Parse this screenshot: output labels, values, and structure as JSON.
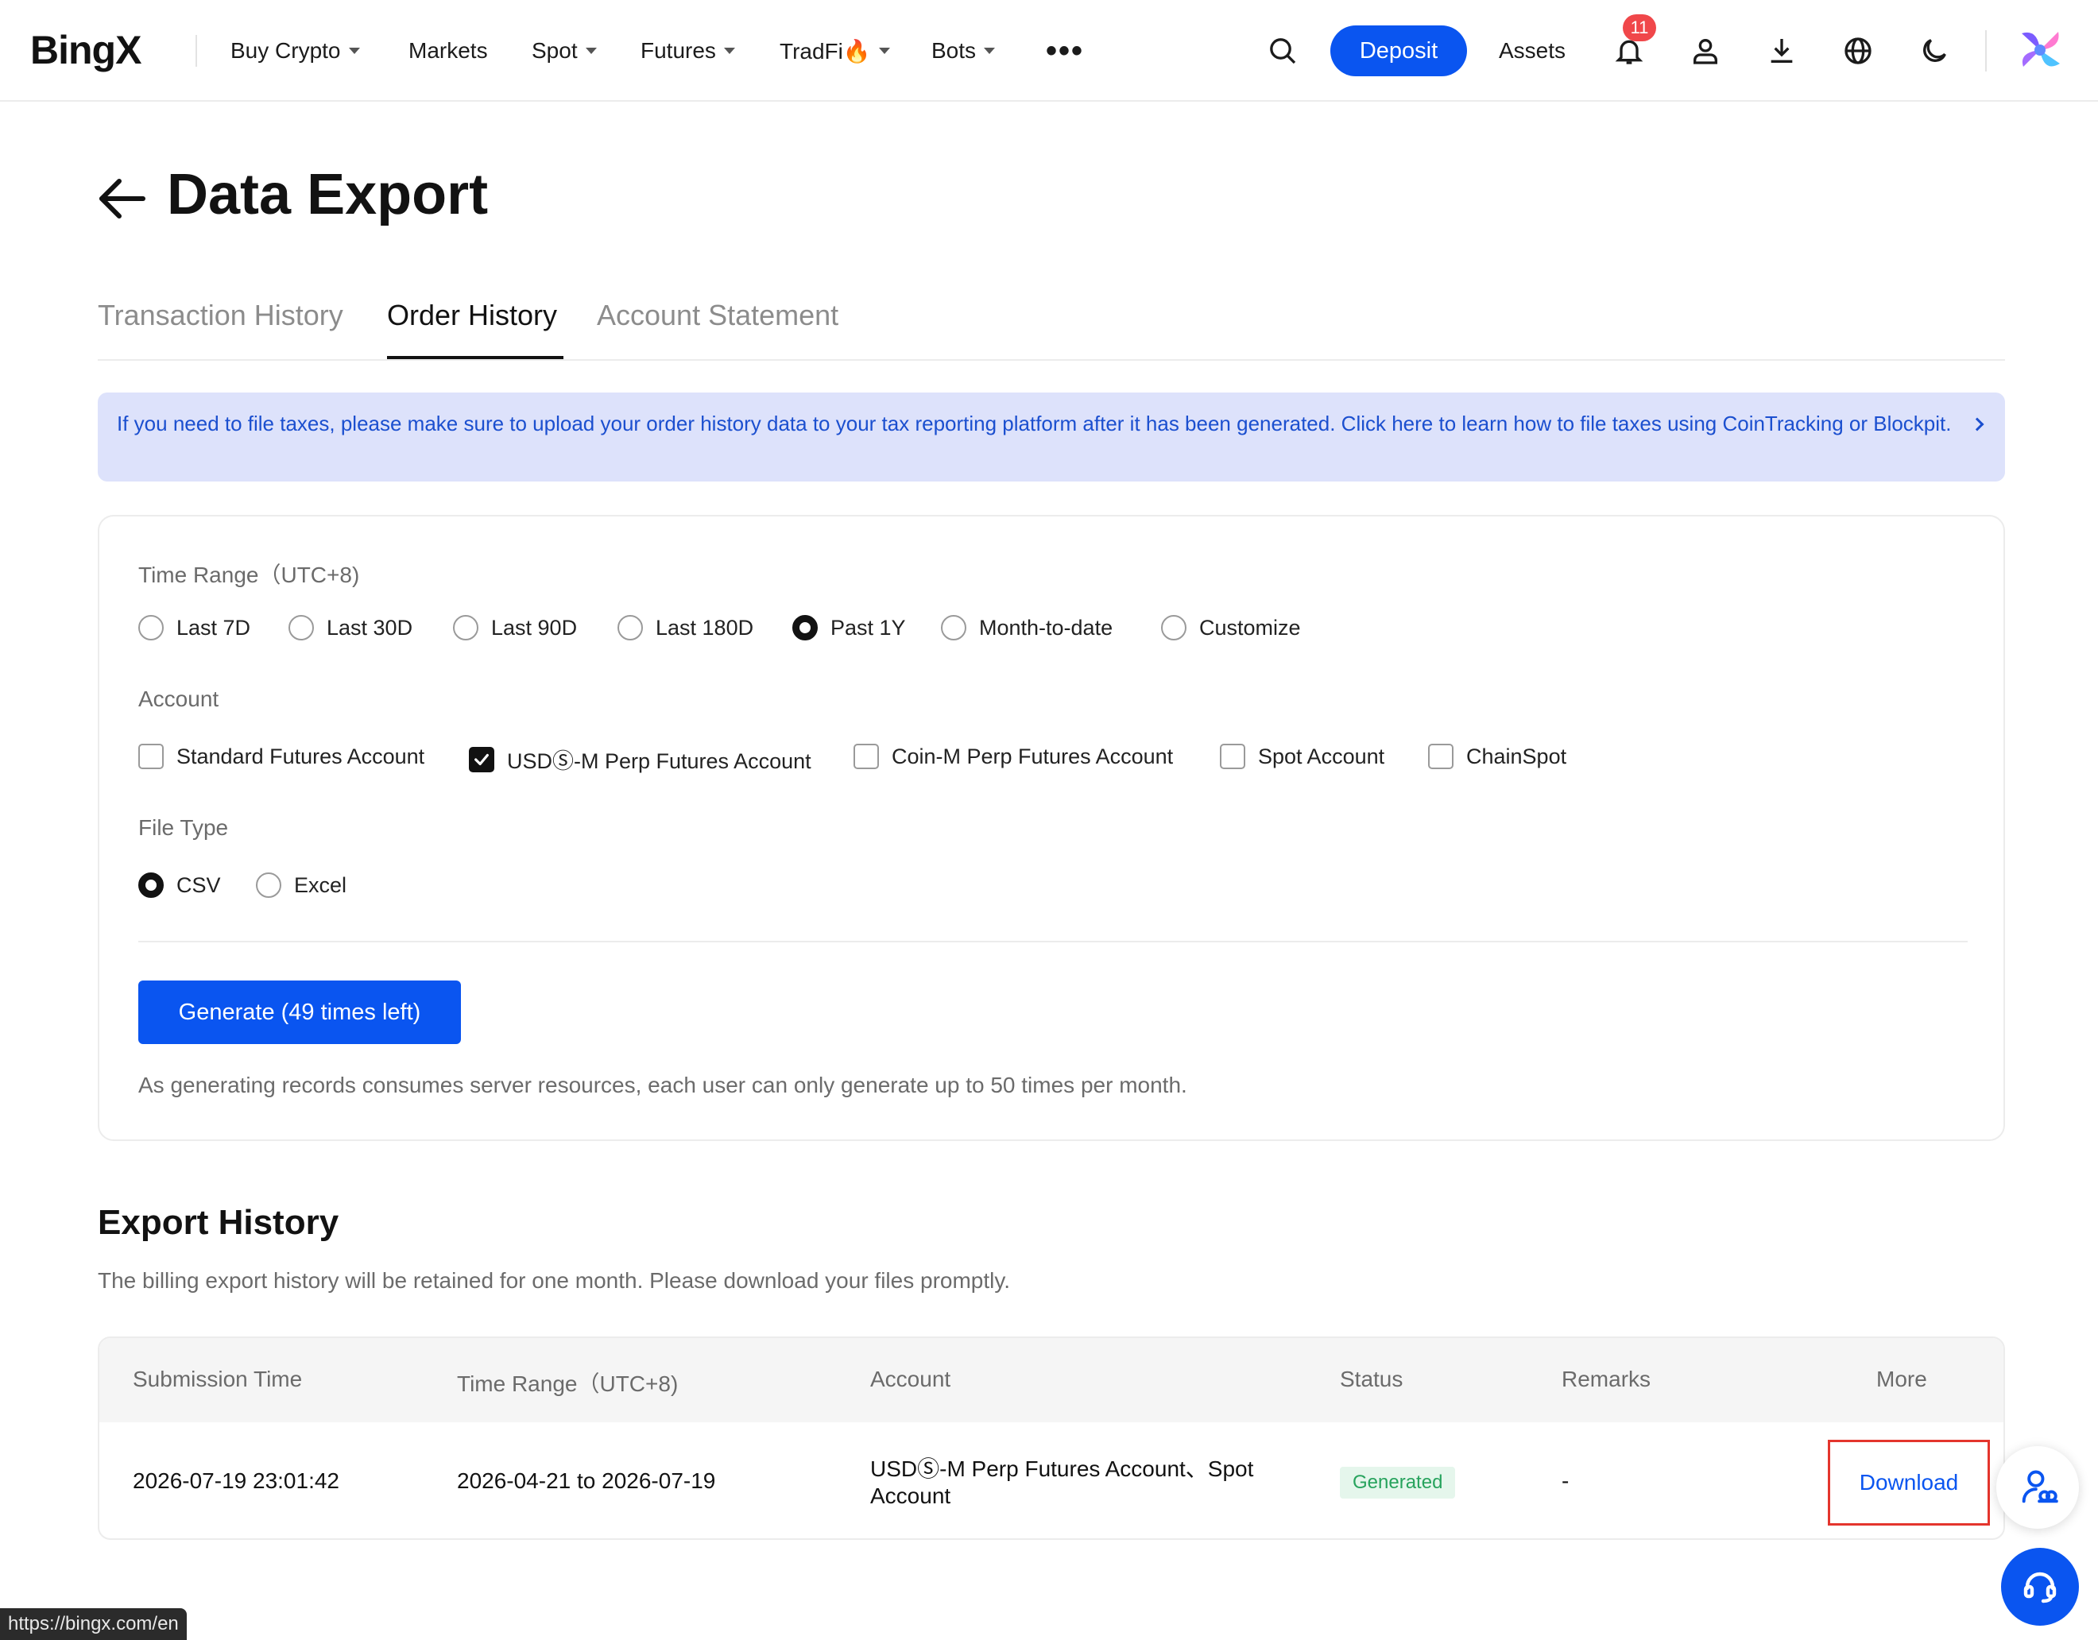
{
  "nav": {
    "logo": "BingX",
    "items": [
      {
        "label": "Buy Crypto",
        "dropdown": true
      },
      {
        "label": "Markets",
        "dropdown": false
      },
      {
        "label": "Spot",
        "dropdown": true
      },
      {
        "label": "Futures",
        "dropdown": true
      },
      {
        "label": "TradFi🔥",
        "dropdown": true
      },
      {
        "label": "Bots",
        "dropdown": true
      }
    ],
    "more_icon": "more-horizontal-icon",
    "deposit_label": "Deposit",
    "assets_label": "Assets",
    "notification_count": "11",
    "accent_color": "#0a55f0"
  },
  "page": {
    "title": "Data Export",
    "tabs": [
      "Transaction History",
      "Order History",
      "Account Statement"
    ],
    "active_tab": "Order History"
  },
  "banner": {
    "text": "If you need to file taxes, please make sure to upload your order history data to your tax reporting platform after it has been generated. Click here to learn how to file taxes using CoinTracking or Blockpit."
  },
  "form": {
    "time_range_label": "Time Range（UTC+8)",
    "time_ranges": [
      "Last 7D",
      "Last 30D",
      "Last 90D",
      "Last 180D",
      "Past 1Y",
      "Month-to-date",
      "Customize"
    ],
    "time_range_selected": "Past 1Y",
    "account_label": "Account",
    "accounts": [
      "Standard Futures Account",
      "USDⓈ-M Perp Futures Account",
      "Coin-M Perp Futures Account",
      "Spot Account",
      "ChainSpot"
    ],
    "accounts_checked": [
      "USDⓈ-M Perp Futures Account"
    ],
    "file_type_label": "File Type",
    "file_types": [
      "CSV",
      "Excel"
    ],
    "file_type_selected": "CSV",
    "generate_label": "Generate (49 times left)",
    "note": "As generating records consumes server resources, each user can only generate up to 50 times per month."
  },
  "export_history": {
    "title": "Export History",
    "subtitle": "The billing export history will be retained for one month. Please download your files promptly.",
    "columns": [
      "Submission Time",
      "Time Range（UTC+8)",
      "Account",
      "Status",
      "Remarks",
      "More"
    ],
    "rows": [
      {
        "submission_time": "2026-07-19 23:01:42",
        "time_range": "2026-04-21 to 2026-07-19",
        "account": "USDⓈ-M Perp Futures Account、Spot Account",
        "status": "Generated",
        "remarks": "-",
        "action": "Download"
      }
    ],
    "status_color": "#27a35d",
    "highlight_color": "#e4352d"
  },
  "status_bar_url": "https://bingx.com/en"
}
